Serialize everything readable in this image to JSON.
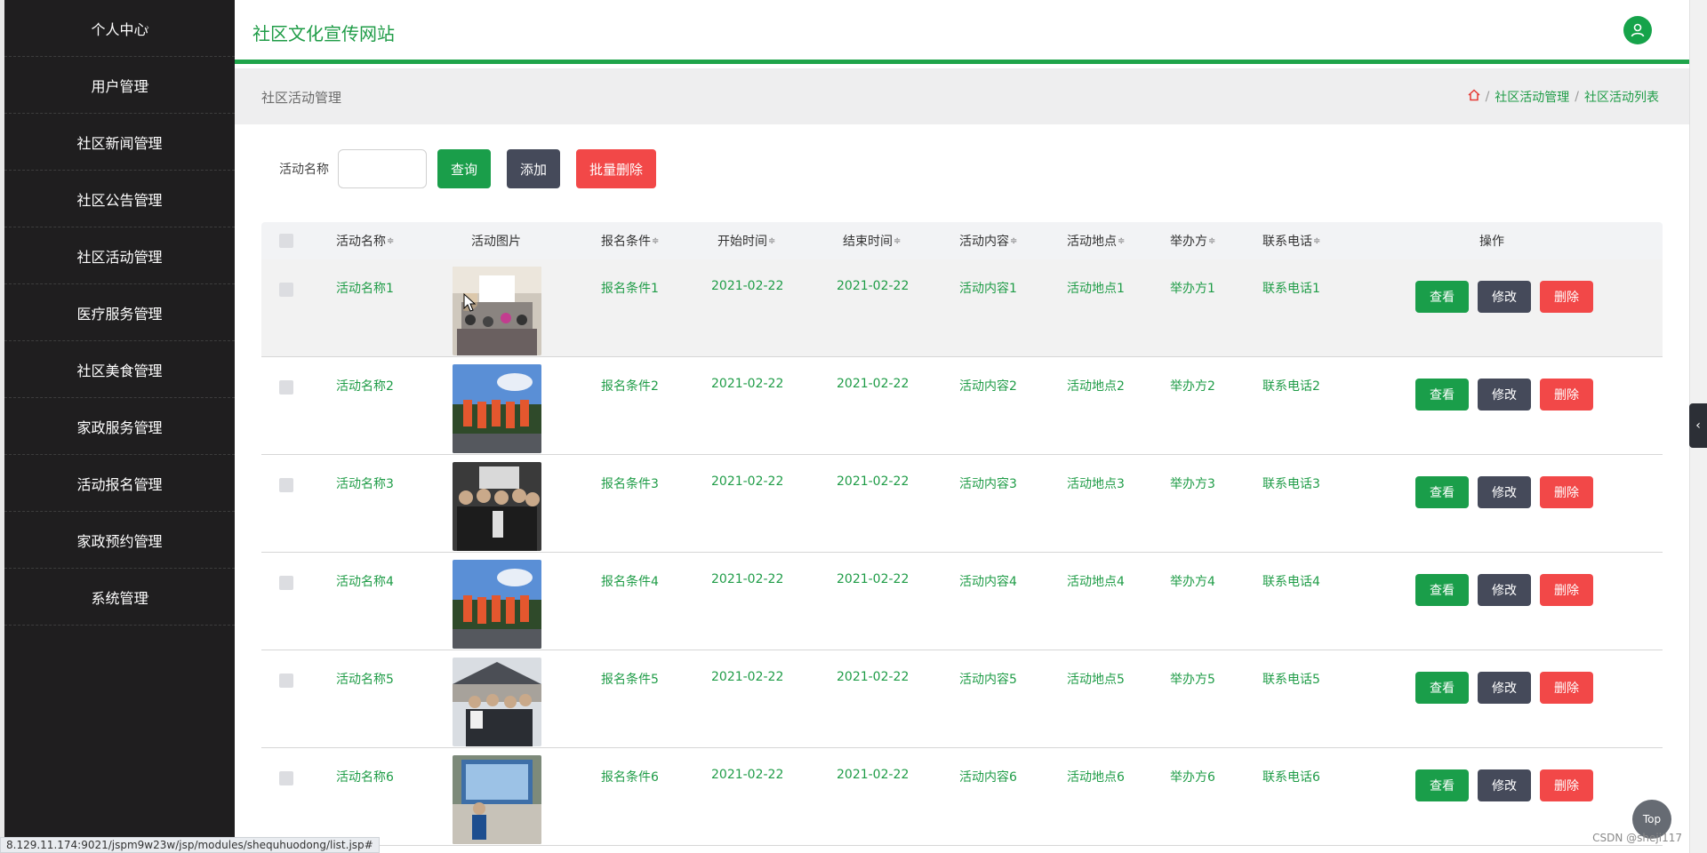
{
  "sidebar": {
    "items": [
      {
        "label": "个人中心"
      },
      {
        "label": "用户管理"
      },
      {
        "label": "社区新闻管理"
      },
      {
        "label": "社区公告管理"
      },
      {
        "label": "社区活动管理"
      },
      {
        "label": "医疗服务管理"
      },
      {
        "label": "社区美食管理"
      },
      {
        "label": "家政服务管理"
      },
      {
        "label": "活动报名管理"
      },
      {
        "label": "家政预约管理"
      },
      {
        "label": "系统管理"
      }
    ]
  },
  "header": {
    "site_title": "社区文化宣传网站",
    "user_icon": "user-icon"
  },
  "breadcrumb": {
    "page_title": "社区活动管理",
    "home_icon": "home-icon",
    "items": [
      "社区活动管理",
      "社区活动列表"
    ],
    "separator": "/"
  },
  "search": {
    "label": "活动名称",
    "value": "",
    "query_label": "查询",
    "add_label": "添加",
    "batch_delete_label": "批量删除"
  },
  "table": {
    "columns": [
      "活动名称",
      "活动图片",
      "报名条件",
      "开始时间",
      "结束时间",
      "活动内容",
      "活动地点",
      "举办方",
      "联系电话",
      "操作"
    ],
    "sort_icon": "≑",
    "rows": [
      {
        "name": "活动名称1",
        "condition": "报名条件1",
        "start": "2021-02-22",
        "end": "2021-02-22",
        "content": "活动内容1",
        "place": "活动地点1",
        "host": "举办方1",
        "phone": "联系电话1"
      },
      {
        "name": "活动名称2",
        "condition": "报名条件2",
        "start": "2021-02-22",
        "end": "2021-02-22",
        "content": "活动内容2",
        "place": "活动地点2",
        "host": "举办方2",
        "phone": "联系电话2"
      },
      {
        "name": "活动名称3",
        "condition": "报名条件3",
        "start": "2021-02-22",
        "end": "2021-02-22",
        "content": "活动内容3",
        "place": "活动地点3",
        "host": "举办方3",
        "phone": "联系电话3"
      },
      {
        "name": "活动名称4",
        "condition": "报名条件4",
        "start": "2021-02-22",
        "end": "2021-02-22",
        "content": "活动内容4",
        "place": "活动地点4",
        "host": "举办方4",
        "phone": "联系电话4"
      },
      {
        "name": "活动名称5",
        "condition": "报名条件5",
        "start": "2021-02-22",
        "end": "2021-02-22",
        "content": "活动内容5",
        "place": "活动地点5",
        "host": "举办方5",
        "phone": "联系电话5"
      },
      {
        "name": "活动名称6",
        "condition": "报名条件6",
        "start": "2021-02-22",
        "end": "2021-02-22",
        "content": "活动内容6",
        "place": "活动地点6",
        "host": "举办方6",
        "phone": "联系电话6"
      }
    ],
    "view_label": "查看",
    "edit_label": "修改",
    "delete_label": "删除"
  },
  "colors": {
    "accent": "#1ea44a",
    "sidebar_bg": "#1f1e1f",
    "danger": "#f24848",
    "dark_button": "#454a5a"
  },
  "misc": {
    "top_button": "Top",
    "status_url": "8.129.11.174:9021/jspm9w23w/jsp/modules/shequhuodong/list.jsp#",
    "watermark": "CSDN @sheji117",
    "collapse_icon": "chevron-left-icon"
  }
}
